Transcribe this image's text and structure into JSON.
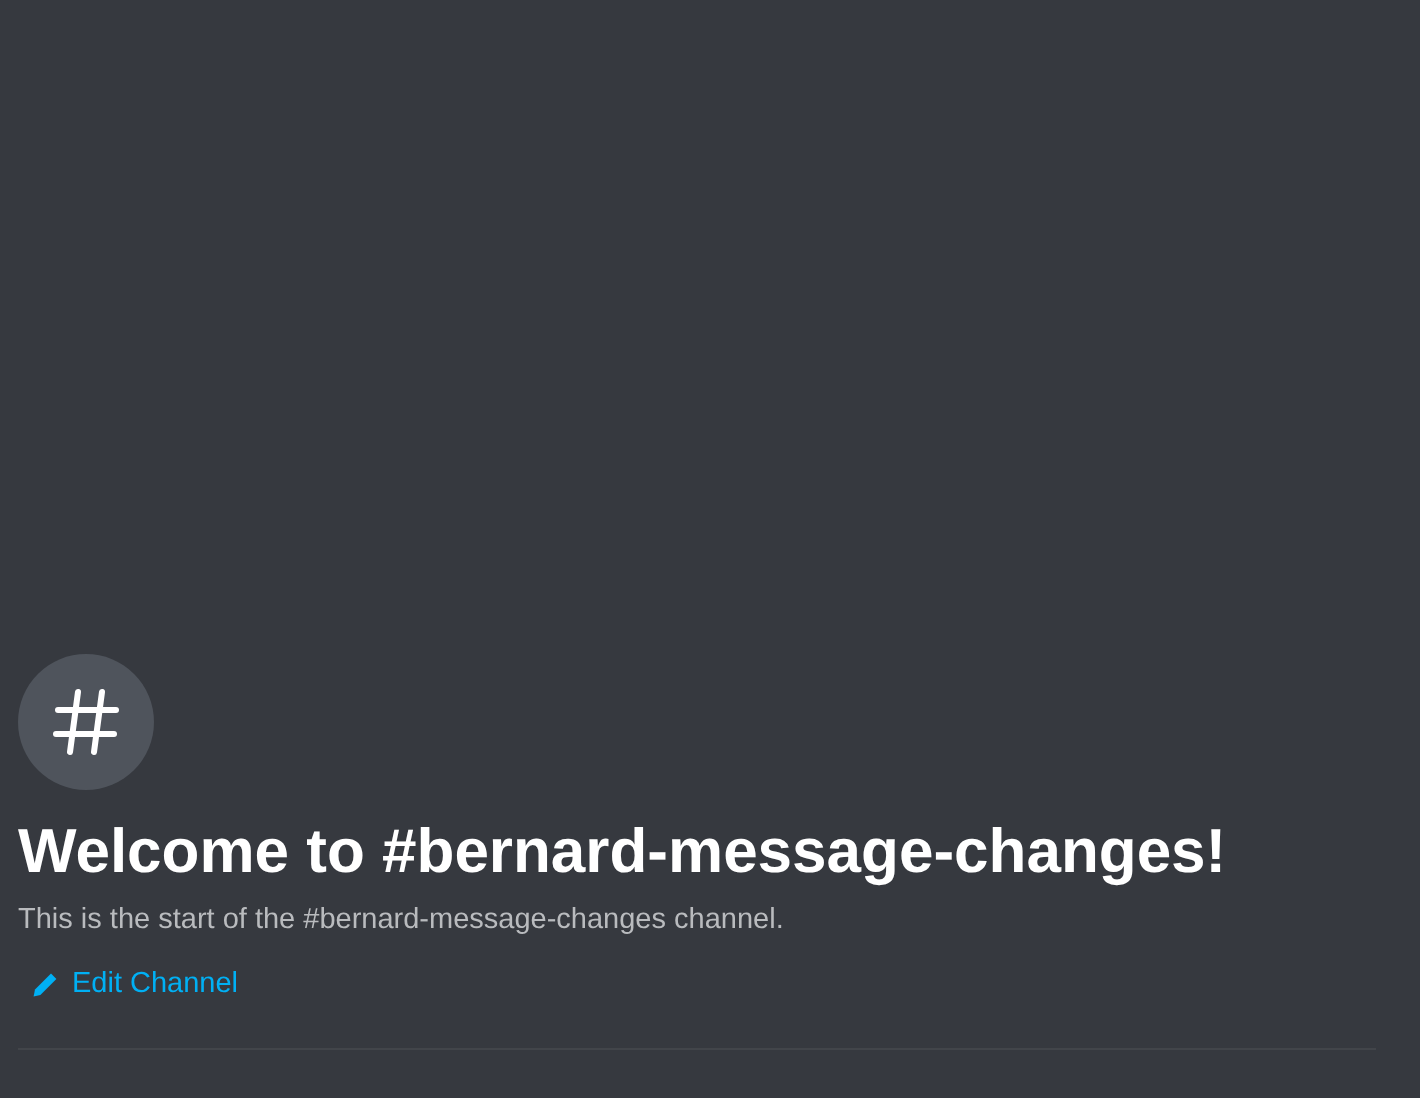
{
  "channel_intro": {
    "title": "Welcome to #bernard-message-changes!",
    "description": "This is the start of the #bernard-message-changes channel.",
    "edit_link": "Edit Channel"
  }
}
